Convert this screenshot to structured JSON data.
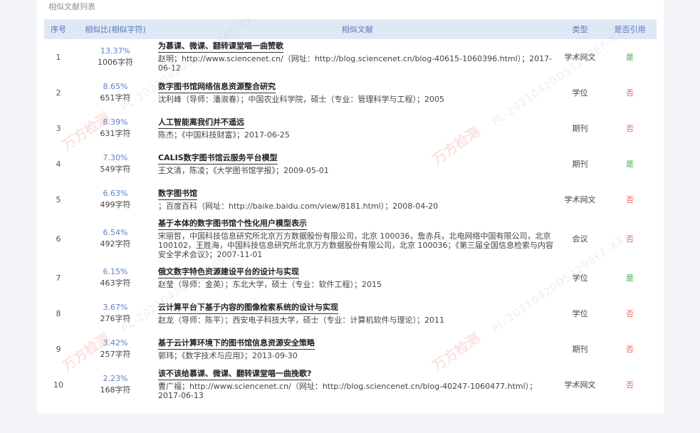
{
  "section_title": "相似文献列表",
  "columns": {
    "index": "序号",
    "similarity": "相似比(相似字符)",
    "document": "相似文献",
    "type": "类型",
    "cited": "是否引用"
  },
  "rows": [
    {
      "index": "1",
      "percent": "13.37%",
      "chars": "1006字符",
      "title": "为慕课、微课、翻转课堂唱一曲赞歌",
      "meta": "赵明；http://www.sciencenet.cn/（网址：http://blog.sciencenet.cn/blog-40615-1060396.html）；2017-06-12",
      "type": "学术网文",
      "cited": "是"
    },
    {
      "index": "2",
      "percent": "8.65%",
      "chars": "651字符",
      "title": "数字图书馆网络信息资源整合研究",
      "meta": "沈利峰（导师：潘淑春）；中国农业科学院，硕士（专业：管理科学与工程）；2005",
      "type": "学位",
      "cited": "否"
    },
    {
      "index": "3",
      "percent": "8.39%",
      "chars": "631字符",
      "title": "人工智能离我们并不遥远",
      "meta": "陈杰；《中国科技财富》；2017-06-25",
      "type": "期刊",
      "cited": "否"
    },
    {
      "index": "4",
      "percent": "7.30%",
      "chars": "549字符",
      "title": "CALIS数字图书馆云服务平台模型",
      "meta": "王文清，陈凌；《大学图书馆学报》；2009-05-01",
      "type": "期刊",
      "cited": "是"
    },
    {
      "index": "5",
      "percent": "6.63%",
      "chars": "499字符",
      "title": "数字图书馆",
      "meta": "；百度百科（网址：http://baike.baidu.com/view/8181.html）；2008-04-20",
      "type": "学术网文",
      "cited": "否"
    },
    {
      "index": "6",
      "percent": "6.54%",
      "chars": "492字符",
      "title": "基于本体的数字图书馆个性化用户模型表示",
      "meta": "宋丽哲，中国科技信息研究所北京万方数据股份有限公司，北京 100036，詹赤兵，北电网络中国有限公司，北京 100102，王胜海，中国科技信息研究所北京万方数据股份有限公司，北京 100036；《第三届全国信息检索与内容安全学术会议》；2007-11-01",
      "type": "会议",
      "cited": "否"
    },
    {
      "index": "7",
      "percent": "6.15%",
      "chars": "463字符",
      "title": "俄文数字特色资源建设平台的设计与实现",
      "meta": "赵莹（导师：金英）；东北大学，硕士（专业：软件工程）；2015",
      "type": "学位",
      "cited": "是"
    },
    {
      "index": "8",
      "percent": "3.67%",
      "chars": "276字符",
      "title": "云计算平台下基于内容的图像检索系统的设计与实现",
      "meta": "赵龙（导师：陈平）；西安电子科技大学，硕士（专业：计算机软件与理论）；2011",
      "type": "学位",
      "cited": "否"
    },
    {
      "index": "9",
      "percent": "3.42%",
      "chars": "257字符",
      "title": "基于云计算环境下的图书馆信息资源安全策略",
      "meta": "郭玮；《数字技术与应用》；2013-09-30",
      "type": "期刊",
      "cited": "否"
    },
    {
      "index": "10",
      "percent": "2.23%",
      "chars": "168字符",
      "title": "该不该给慕课、微课、翻转课堂唱一曲挽歌?",
      "meta": "曹广福；http://www.sciencenet.cn/（网址：http://blog.sciencenet.cn/blog-40247-1060477.html）；2017-06-13",
      "type": "学术网文",
      "cited": "否"
    }
  ],
  "watermark": {
    "code": "PL-20210420D51298EF-XX",
    "logo": "万方检测"
  }
}
